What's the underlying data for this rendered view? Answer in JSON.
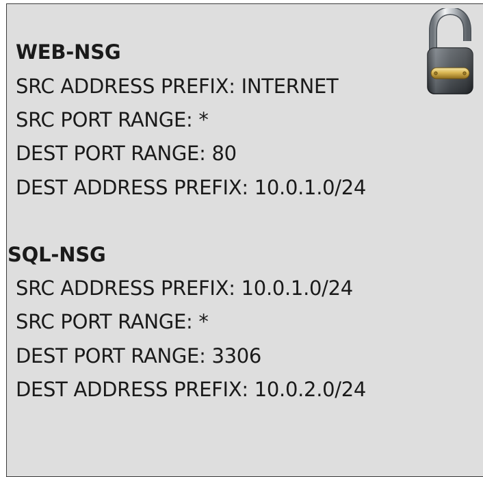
{
  "groups": [
    {
      "name": "WEB-NSG",
      "src_address_prefix": "SRC ADDRESS PREFIX: INTERNET",
      "src_port_range": "SRC PORT RANGE: *",
      "dest_port_range": "DEST PORT RANGE: 80",
      "dest_address_prefix": "DEST ADDRESS PREFIX: 10.0.1.0/24"
    },
    {
      "name": "SQL-NSG",
      "src_address_prefix": "SRC ADDRESS PREFIX: 10.0.1.0/24",
      "src_port_range": "SRC PORT RANGE: *",
      "dest_port_range": "DEST PORT RANGE: 3306",
      "dest_address_prefix": "DEST ADDRESS PREFIX: 10.0.2.0/24"
    }
  ],
  "icon": "padlock-icon",
  "colors": {
    "panel_background": "#dedede",
    "border": "#3a3a3a",
    "text": "#1a1a1a"
  }
}
